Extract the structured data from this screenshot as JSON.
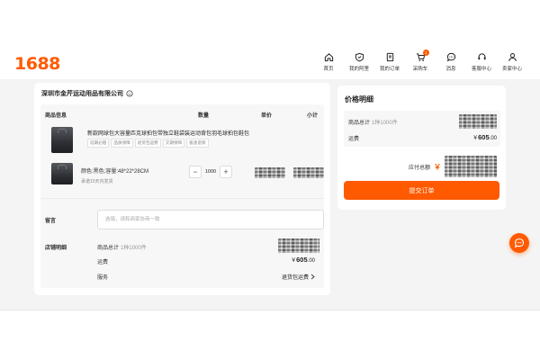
{
  "header": {
    "logo": "1688",
    "nav": [
      {
        "label": "首页",
        "icon": "home-icon"
      },
      {
        "label": "我的阿里",
        "icon": "heart-shield-icon"
      },
      {
        "label": "我的订单",
        "icon": "order-icon"
      },
      {
        "label": "采购车",
        "icon": "cart-icon",
        "badge": "1"
      },
      {
        "label": "消息",
        "icon": "message-icon"
      },
      {
        "label": "客服中心",
        "icon": "headset-icon"
      },
      {
        "label": "卖家中心",
        "icon": "user-icon"
      }
    ]
  },
  "order": {
    "shop_name": "深圳市金芹运动用品有限公司",
    "columns": [
      "商品信息",
      "数量",
      "单价",
      "小计"
    ],
    "product": {
      "title": "新款网球包大容量匹克球拍包带独立鞋袋装运动背包羽毛球拍包鞋包",
      "tags": [
        "延期必赔",
        "品质保障",
        "退货包运费",
        "交期保障",
        "极速退款"
      ],
      "sku": "颜色:黑色;容量:48*22*28CM",
      "ship_note": "承诺15天内发货",
      "quantity": "1000",
      "minus": "−",
      "plus": "+"
    },
    "message_label": "留言",
    "message_placeholder": "选填，请和商家协商一致",
    "shop_detail_label": "店铺明细",
    "goods_total_label": "商品总计",
    "goods_total_desc": "1种1000件",
    "freight_label": "运费",
    "freight_yen": "￥",
    "freight_int": "605",
    "freight_dec": ".00",
    "service_label": "服务",
    "service_value": "退货包运费"
  },
  "price": {
    "title": "价格明细",
    "goods_total_label": "商品总计",
    "goods_total_desc": "1种1000件",
    "freight_label": "运费",
    "freight_yen": "￥",
    "freight_int": "605",
    "freight_dec": ".00",
    "payable_label": "应付总额",
    "yen": "￥",
    "submit_label": "提交订单"
  },
  "colors": {
    "accent": "#ff5a00"
  }
}
